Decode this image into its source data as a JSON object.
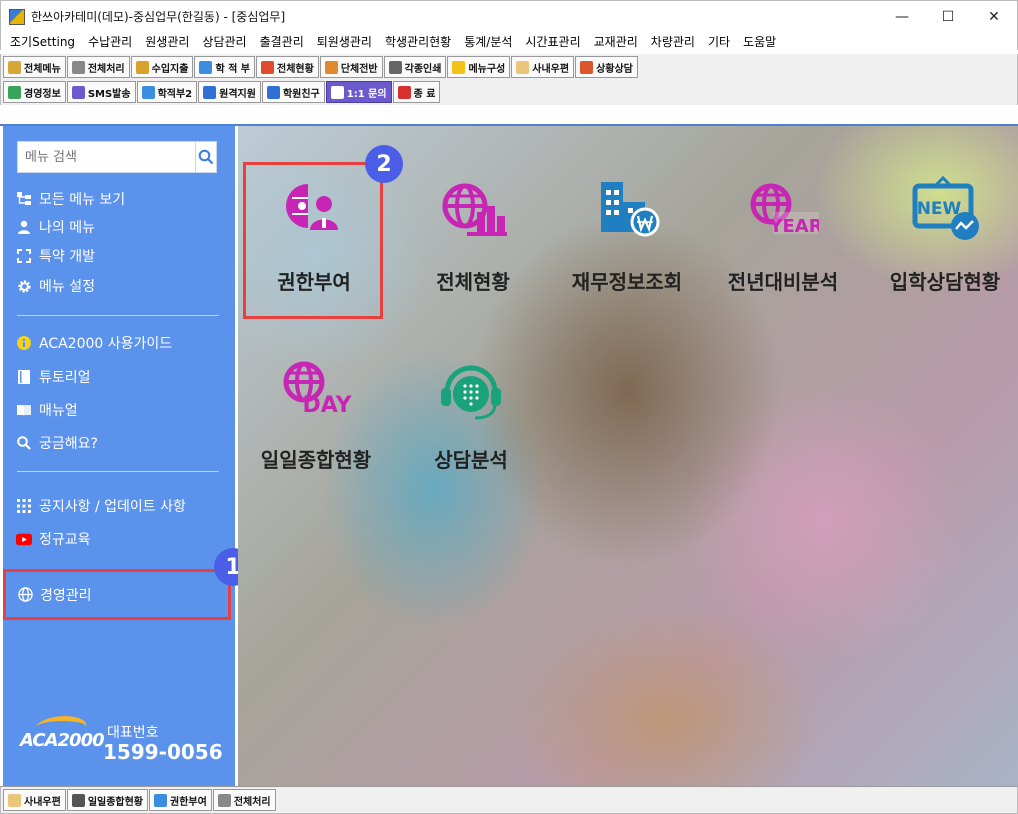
{
  "window": {
    "title": "한쓰아카테미(데모)-중심업무(한길동) - [중심업무]",
    "minimize": "—",
    "maximize": "☐",
    "close": "✕"
  },
  "menubar": [
    "조기Setting",
    "수납관리",
    "원생관리",
    "상담관리",
    "출결관리",
    "퇴원생관리",
    "학생관리현황",
    "통계/분석",
    "시간표관리",
    "교재관리",
    "차량관리",
    "기타",
    "도움말"
  ],
  "toolbar1": [
    {
      "label": "전체메뉴",
      "icon": "building-icon",
      "color": "#d6a63a"
    },
    {
      "label": "전체처리",
      "icon": "gears-icon",
      "color": "#888888"
    },
    {
      "label": "수입지출",
      "icon": "money-bag-icon",
      "color": "#d9a22b"
    },
    {
      "label": "학 적 부",
      "icon": "student-icon",
      "color": "#3c8de0"
    },
    {
      "label": "전체현황",
      "icon": "pie-chart-icon",
      "color": "#e04a2f"
    },
    {
      "label": "단체전반",
      "icon": "group-icon",
      "color": "#e08a2f"
    },
    {
      "label": "각종인쇄",
      "icon": "printer-icon",
      "color": "#666666"
    },
    {
      "label": "메뉴구성",
      "icon": "star-icon",
      "color": "#f2c21b"
    },
    {
      "label": "사내우편",
      "icon": "envelope-icon",
      "color": "#e9c67a"
    },
    {
      "label": "상황상담",
      "icon": "counselor-icon",
      "color": "#d9572b"
    }
  ],
  "toolbar2": [
    {
      "label": "경영정보",
      "icon": "globe-icon",
      "color": "#3aa35a"
    },
    {
      "label": "SMS발송",
      "icon": "phone-icon",
      "color": "#6a5acd"
    },
    {
      "label": "학적부2",
      "icon": "pencil-icon",
      "color": "#3c8de0"
    },
    {
      "label": "원격지원",
      "icon": "monitor-icon",
      "color": "#2f6fd6"
    },
    {
      "label": "학원친구",
      "icon": "chat-icon",
      "color": "#2f6fd6"
    },
    {
      "label": "1:1 문의",
      "icon": "headset-icon",
      "color": "#ffffff"
    },
    {
      "label": "종  료",
      "icon": "power-icon",
      "color": "#d63030"
    }
  ],
  "sidebar": {
    "search_placeholder": "메뉴 검색",
    "group1": [
      {
        "label": "모든 메뉴 보기",
        "icon": "sitemap-icon"
      },
      {
        "label": "나의 메뉴",
        "icon": "user-icon"
      },
      {
        "label": "특약 개발",
        "icon": "expand-icon"
      },
      {
        "label": "메뉴 설정",
        "icon": "gear-icon"
      }
    ],
    "group2": [
      {
        "label": "ACA2000 사용가이드",
        "icon": "info-icon"
      },
      {
        "label": "튜토리얼",
        "icon": "book-icon"
      },
      {
        "label": "매뉴얼",
        "icon": "manual-icon"
      },
      {
        "label": "궁금해요?",
        "icon": "search-icon"
      }
    ],
    "group3": [
      {
        "label": "공지사항 / 업데이트 사항",
        "icon": "grid-icon"
      },
      {
        "label": "정규교육",
        "icon": "youtube-icon"
      }
    ],
    "selected": {
      "label": "경영관리",
      "icon": "globe-icon"
    },
    "badge1": "1",
    "logo_text": "ACA2000",
    "phone_label": "대표번호",
    "phone_number": "1599-0056"
  },
  "tiles": [
    {
      "label": "권한부여",
      "icon": "permission-icon",
      "color": "#c726b5"
    },
    {
      "label": "전체현황",
      "icon": "globe-chart-icon",
      "color": "#c726b5"
    },
    {
      "label": "재무정보조회",
      "icon": "finance-building-icon",
      "color": "#1f7fc1"
    },
    {
      "label": "전년대비분석",
      "icon": "globe-year-icon",
      "color": "#c726b5"
    },
    {
      "label": "입학상담현황",
      "icon": "new-sign-icon",
      "color": "#1f7fc1"
    },
    {
      "label": "일일종합현황",
      "icon": "globe-day-icon",
      "color": "#c726b5"
    },
    {
      "label": "상담분석",
      "icon": "headset-icon",
      "color": "#1aa37a"
    }
  ],
  "badge2": "2",
  "tile_text": {
    "new": "NEW",
    "year": "YEAR",
    "day": "DAY"
  },
  "bottombar": [
    {
      "label": "사내우편",
      "icon": "envelope-icon",
      "color": "#e9c67a"
    },
    {
      "label": "일일종합현황",
      "icon": "chart-icon",
      "color": "#555555"
    },
    {
      "label": "권한부여",
      "icon": "shield-icon",
      "color": "#3c8de0"
    },
    {
      "label": "전체처리",
      "icon": "gears-icon",
      "color": "#888888"
    }
  ]
}
